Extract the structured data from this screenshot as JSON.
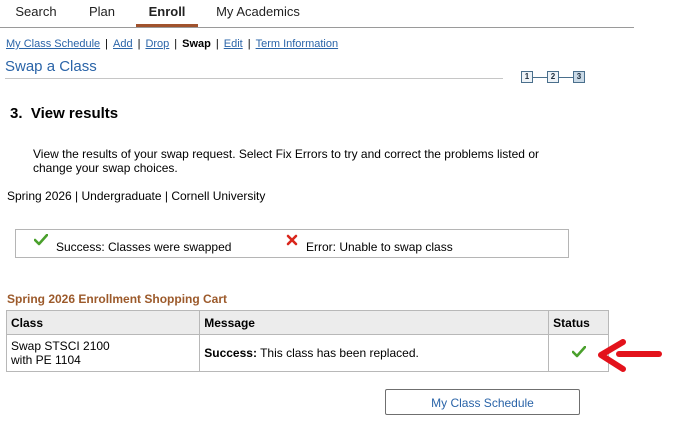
{
  "tabs": [
    {
      "label": "Search",
      "active": false
    },
    {
      "label": "Plan",
      "active": false
    },
    {
      "label": "Enroll",
      "active": true
    },
    {
      "label": "My Academics",
      "active": false
    }
  ],
  "subnav": {
    "schedule": "My Class Schedule",
    "add": "Add",
    "drop": "Drop",
    "swap": "Swap",
    "edit": "Edit",
    "term_info": "Term Information",
    "separator": "|"
  },
  "page_title": "Swap a Class",
  "steps": [
    "1",
    "2",
    "3"
  ],
  "current_step": 3,
  "section_heading": "3.  View results",
  "instructions": "View the results of your swap request.  Select Fix Errors to try and correct the problems listed or change your swap choices.",
  "term_line": "Spring 2026 | Undergraduate | Cornell University",
  "legend": {
    "success": "Success: Classes were swapped",
    "error": "Error: Unable to swap class"
  },
  "cart": {
    "title": "Spring 2026 Enrollment Shopping Cart",
    "headers": {
      "class": "Class",
      "message": "Message",
      "status": "Status"
    },
    "rows": [
      {
        "class_line1": "Swap STSCI 2100",
        "class_line2": "with PE 1104",
        "message_bold": "Success:",
        "message_text": " This class has been replaced.",
        "status": "success"
      }
    ]
  },
  "button": {
    "label": "My Class Schedule"
  },
  "colors": {
    "link": "#2a64a8",
    "accent": "#a0522d",
    "success": "#4aa02c",
    "error": "#d9261c",
    "annotation": "#e3121b"
  }
}
